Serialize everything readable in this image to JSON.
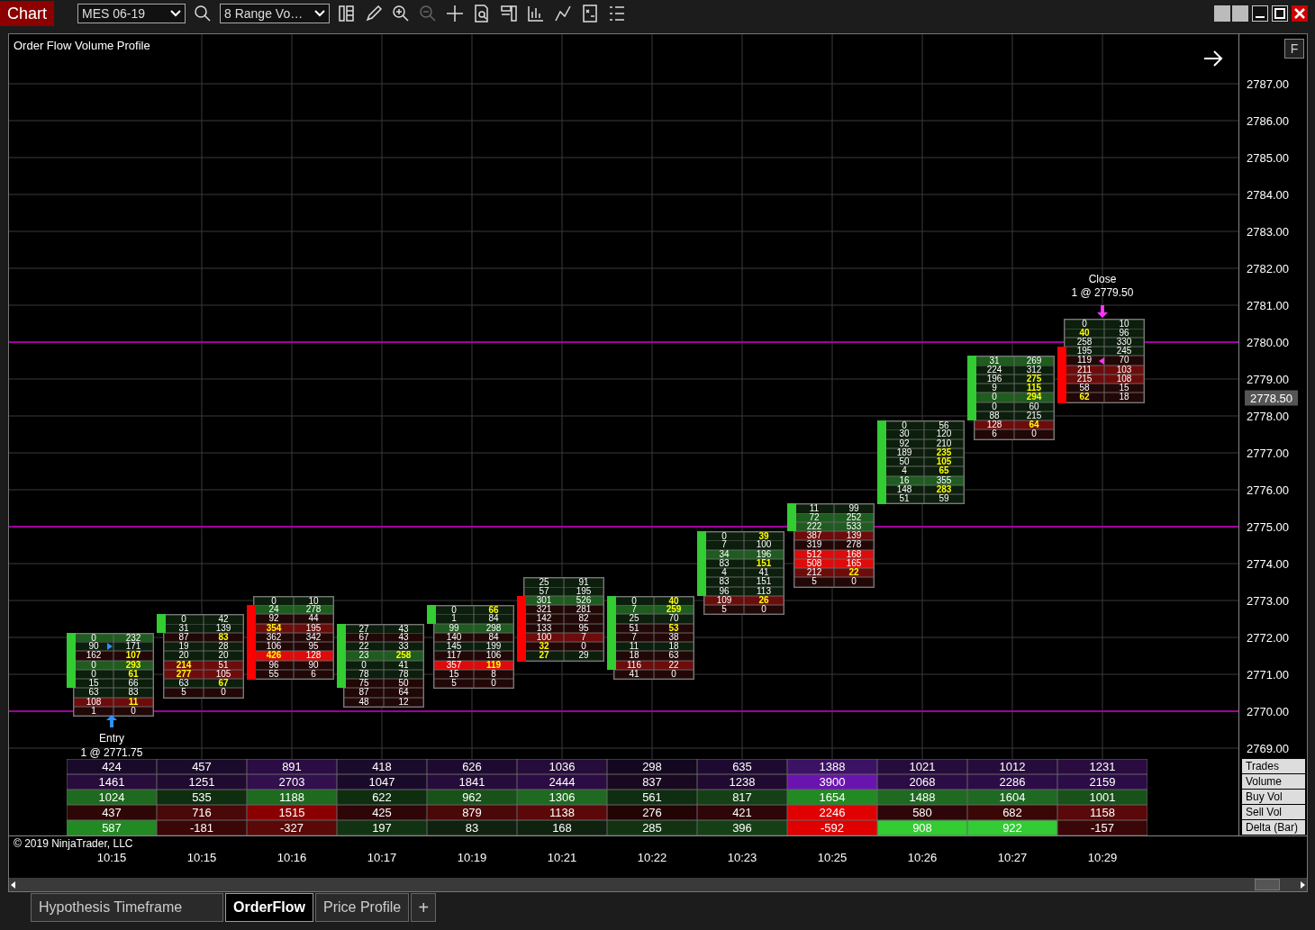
{
  "toolbar": {
    "title": "Chart",
    "instrument": "MES 06-19",
    "bar_type": "8 Range Vo…"
  },
  "chart": {
    "title": "Order Flow Volume Profile",
    "panel_button": "F",
    "current_price": "2778.50",
    "price_ticks": [
      "2787.00",
      "2786.00",
      "2785.00",
      "2784.00",
      "2783.00",
      "2782.00",
      "2781.00",
      "2780.00",
      "2779.00",
      "2778.00",
      "2777.00",
      "2776.00",
      "2775.00",
      "2774.00",
      "2773.00",
      "2772.00",
      "2771.00",
      "2770.00",
      "2769.00"
    ],
    "entry": {
      "label": "Entry",
      "fill": "1 @ 2771.75"
    },
    "close": {
      "label": "Close",
      "fill": "1 @ 2779.50"
    },
    "bars": [
      {
        "time": "10:15",
        "rising": true,
        "rows": [
          {
            "bid": "0",
            "ask": "232",
            "kind": "buy-strong",
            "hot_bid": false,
            "hot_ask": false,
            "body": true
          },
          {
            "bid": "90",
            "ask": "171",
            "kind": "buy",
            "hot_bid": false,
            "hot_ask": false,
            "body": true
          },
          {
            "bid": "162",
            "ask": "107",
            "kind": "sell",
            "hot_bid": false,
            "hot_ask": true,
            "body": true
          },
          {
            "bid": "0",
            "ask": "293",
            "kind": "buy-strong",
            "hot_bid": false,
            "hot_ask": true,
            "body": true
          },
          {
            "bid": "0",
            "ask": "61",
            "kind": "buy",
            "hot_bid": false,
            "hot_ask": true,
            "body": true
          },
          {
            "bid": "15",
            "ask": "66",
            "kind": "buy",
            "hot_bid": false,
            "hot_ask": false,
            "body": true
          },
          {
            "bid": "63",
            "ask": "83",
            "kind": "buy",
            "hot_bid": false,
            "hot_ask": false,
            "body": false
          },
          {
            "bid": "108",
            "ask": "11",
            "kind": "sell-strong",
            "hot_bid": false,
            "hot_ask": true,
            "body": false
          },
          {
            "bid": "1",
            "ask": "0",
            "kind": "sell",
            "hot_bid": false,
            "hot_ask": false,
            "body": false
          }
        ]
      },
      {
        "time": "10:15",
        "rising": true,
        "rows": [
          {
            "bid": "0",
            "ask": "42",
            "kind": "buy",
            "hot_bid": false,
            "hot_ask": false,
            "body": true
          },
          {
            "bid": "31",
            "ask": "139",
            "kind": "buy",
            "hot_bid": false,
            "hot_ask": false,
            "body": true
          },
          {
            "bid": "87",
            "ask": "83",
            "kind": "sell",
            "hot_bid": false,
            "hot_ask": true,
            "body": false
          },
          {
            "bid": "19",
            "ask": "28",
            "kind": "buy",
            "hot_bid": false,
            "hot_ask": false,
            "body": false
          },
          {
            "bid": "20",
            "ask": "20",
            "kind": "buy",
            "hot_bid": false,
            "hot_ask": false,
            "body": false
          },
          {
            "bid": "214",
            "ask": "51",
            "kind": "sell-strong",
            "hot_bid": true,
            "hot_ask": false,
            "body": false
          },
          {
            "bid": "277",
            "ask": "105",
            "kind": "sell-strong",
            "hot_bid": true,
            "hot_ask": false,
            "body": false
          },
          {
            "bid": "63",
            "ask": "67",
            "kind": "buy",
            "hot_bid": false,
            "hot_ask": true,
            "body": false
          },
          {
            "bid": "5",
            "ask": "0",
            "kind": "sell",
            "hot_bid": false,
            "hot_ask": false,
            "body": false
          }
        ]
      },
      {
        "time": "10:16",
        "rising": false,
        "rows": [
          {
            "bid": "0",
            "ask": "10",
            "kind": "buy",
            "hot_bid": false,
            "hot_ask": false,
            "body": false
          },
          {
            "bid": "24",
            "ask": "278",
            "kind": "buy-strong",
            "hot_bid": false,
            "hot_ask": false,
            "body": true
          },
          {
            "bid": "92",
            "ask": "44",
            "kind": "sell",
            "hot_bid": false,
            "hot_ask": false,
            "body": true
          },
          {
            "bid": "354",
            "ask": "195",
            "kind": "sell-strong",
            "hot_bid": true,
            "hot_ask": false,
            "body": true
          },
          {
            "bid": "362",
            "ask": "342",
            "kind": "sell",
            "hot_bid": false,
            "hot_ask": false,
            "body": true
          },
          {
            "bid": "106",
            "ask": "95",
            "kind": "sell",
            "hot_bid": false,
            "hot_ask": false,
            "body": true
          },
          {
            "bid": "426",
            "ask": "128",
            "kind": "sell-max",
            "hot_bid": true,
            "hot_ask": false,
            "body": true
          },
          {
            "bid": "96",
            "ask": "90",
            "kind": "sell",
            "hot_bid": false,
            "hot_ask": false,
            "body": true
          },
          {
            "bid": "55",
            "ask": "6",
            "kind": "sell",
            "hot_bid": false,
            "hot_ask": false,
            "body": true
          }
        ]
      },
      {
        "time": "10:17",
        "rising": true,
        "rows": [
          {
            "bid": "27",
            "ask": "43",
            "kind": "buy",
            "hot_bid": false,
            "hot_ask": false,
            "body": true
          },
          {
            "bid": "67",
            "ask": "43",
            "kind": "sell",
            "hot_bid": false,
            "hot_ask": false,
            "body": true
          },
          {
            "bid": "22",
            "ask": "33",
            "kind": "buy",
            "hot_bid": false,
            "hot_ask": false,
            "body": true
          },
          {
            "bid": "23",
            "ask": "258",
            "kind": "buy-strong",
            "hot_bid": false,
            "hot_ask": true,
            "body": true
          },
          {
            "bid": "0",
            "ask": "41",
            "kind": "buy",
            "hot_bid": false,
            "hot_ask": false,
            "body": true
          },
          {
            "bid": "78",
            "ask": "78",
            "kind": "buy",
            "hot_bid": false,
            "hot_ask": false,
            "body": true
          },
          {
            "bid": "75",
            "ask": "50",
            "kind": "sell",
            "hot_bid": false,
            "hot_ask": false,
            "body": true
          },
          {
            "bid": "87",
            "ask": "64",
            "kind": "sell",
            "hot_bid": false,
            "hot_ask": false,
            "body": false
          },
          {
            "bid": "48",
            "ask": "12",
            "kind": "sell",
            "hot_bid": false,
            "hot_ask": false,
            "body": false
          }
        ]
      },
      {
        "time": "10:19",
        "rising": true,
        "rows": [
          {
            "bid": "0",
            "ask": "66",
            "kind": "buy",
            "hot_bid": false,
            "hot_ask": true,
            "body": true
          },
          {
            "bid": "1",
            "ask": "84",
            "kind": "buy",
            "hot_bid": false,
            "hot_ask": false,
            "body": true
          },
          {
            "bid": "99",
            "ask": "298",
            "kind": "buy-strong",
            "hot_bid": false,
            "hot_ask": false,
            "body": false
          },
          {
            "bid": "140",
            "ask": "84",
            "kind": "sell",
            "hot_bid": false,
            "hot_ask": false,
            "body": false
          },
          {
            "bid": "145",
            "ask": "199",
            "kind": "buy",
            "hot_bid": false,
            "hot_ask": false,
            "body": false
          },
          {
            "bid": "117",
            "ask": "106",
            "kind": "sell",
            "hot_bid": false,
            "hot_ask": false,
            "body": false
          },
          {
            "bid": "357",
            "ask": "119",
            "kind": "sell-max",
            "hot_bid": false,
            "hot_ask": true,
            "body": false
          },
          {
            "bid": "15",
            "ask": "8",
            "kind": "sell",
            "hot_bid": false,
            "hot_ask": false,
            "body": false
          },
          {
            "bid": "5",
            "ask": "0",
            "kind": "sell",
            "hot_bid": false,
            "hot_ask": false,
            "body": false
          }
        ]
      },
      {
        "time": "10:21",
        "rising": false,
        "rows": [
          {
            "bid": "25",
            "ask": "91",
            "kind": "buy",
            "hot_bid": false,
            "hot_ask": false,
            "body": false
          },
          {
            "bid": "57",
            "ask": "195",
            "kind": "buy",
            "hot_bid": false,
            "hot_ask": false,
            "body": false
          },
          {
            "bid": "301",
            "ask": "526",
            "kind": "buy-strong",
            "hot_bid": false,
            "hot_ask": false,
            "body": true
          },
          {
            "bid": "321",
            "ask": "281",
            "kind": "sell",
            "hot_bid": false,
            "hot_ask": false,
            "body": true
          },
          {
            "bid": "142",
            "ask": "82",
            "kind": "sell",
            "hot_bid": false,
            "hot_ask": false,
            "body": true
          },
          {
            "bid": "133",
            "ask": "95",
            "kind": "sell",
            "hot_bid": false,
            "hot_ask": false,
            "body": true
          },
          {
            "bid": "100",
            "ask": "7",
            "kind": "sell-strong",
            "hot_bid": false,
            "hot_ask": false,
            "body": true
          },
          {
            "bid": "32",
            "ask": "0",
            "kind": "sell",
            "hot_bid": true,
            "hot_ask": false,
            "body": true
          },
          {
            "bid": "27",
            "ask": "29",
            "kind": "buy",
            "hot_bid": true,
            "hot_ask": false,
            "body": true
          }
        ]
      },
      {
        "time": "10:22",
        "rising": true,
        "rows": [
          {
            "bid": "0",
            "ask": "40",
            "kind": "buy",
            "hot_bid": false,
            "hot_ask": true,
            "body": true
          },
          {
            "bid": "7",
            "ask": "259",
            "kind": "buy-strong",
            "hot_bid": false,
            "hot_ask": true,
            "body": true
          },
          {
            "bid": "25",
            "ask": "70",
            "kind": "buy",
            "hot_bid": false,
            "hot_ask": false,
            "body": true
          },
          {
            "bid": "51",
            "ask": "53",
            "kind": "sell",
            "hot_bid": false,
            "hot_ask": true,
            "body": true
          },
          {
            "bid": "7",
            "ask": "38",
            "kind": "sell",
            "hot_bid": false,
            "hot_ask": false,
            "body": true
          },
          {
            "bid": "11",
            "ask": "18",
            "kind": "buy",
            "hot_bid": false,
            "hot_ask": false,
            "body": true
          },
          {
            "bid": "18",
            "ask": "63",
            "kind": "sell",
            "hot_bid": false,
            "hot_ask": false,
            "body": true
          },
          {
            "bid": "116",
            "ask": "22",
            "kind": "sell-strong",
            "hot_bid": false,
            "hot_ask": false,
            "body": true
          },
          {
            "bid": "41",
            "ask": "0",
            "kind": "sell",
            "hot_bid": false,
            "hot_ask": false,
            "body": false
          }
        ]
      },
      {
        "time": "10:23",
        "rising": true,
        "rows": [
          {
            "bid": "0",
            "ask": "39",
            "kind": "buy",
            "hot_bid": false,
            "hot_ask": true,
            "body": true
          },
          {
            "bid": "7",
            "ask": "100",
            "kind": "buy",
            "hot_bid": false,
            "hot_ask": false,
            "body": true
          },
          {
            "bid": "34",
            "ask": "196",
            "kind": "buy-strong",
            "hot_bid": false,
            "hot_ask": false,
            "body": true
          },
          {
            "bid": "83",
            "ask": "151",
            "kind": "buy",
            "hot_bid": false,
            "hot_ask": true,
            "body": true
          },
          {
            "bid": "4",
            "ask": "41",
            "kind": "buy",
            "hot_bid": false,
            "hot_ask": false,
            "body": true
          },
          {
            "bid": "83",
            "ask": "151",
            "kind": "buy",
            "hot_bid": false,
            "hot_ask": false,
            "body": true
          },
          {
            "bid": "96",
            "ask": "113",
            "kind": "buy",
            "hot_bid": false,
            "hot_ask": false,
            "body": true
          },
          {
            "bid": "109",
            "ask": "26",
            "kind": "sell-strong",
            "hot_bid": false,
            "hot_ask": true,
            "body": false
          },
          {
            "bid": "5",
            "ask": "0",
            "kind": "sell",
            "hot_bid": false,
            "hot_ask": false,
            "body": false
          }
        ]
      },
      {
        "time": "10:25",
        "rising": true,
        "rows": [
          {
            "bid": "11",
            "ask": "99",
            "kind": "buy",
            "hot_bid": false,
            "hot_ask": false,
            "body": true
          },
          {
            "bid": "72",
            "ask": "252",
            "kind": "buy-strong",
            "hot_bid": false,
            "hot_ask": false,
            "body": true
          },
          {
            "bid": "222",
            "ask": "533",
            "kind": "buy-strong",
            "hot_bid": false,
            "hot_ask": false,
            "body": true
          },
          {
            "bid": "387",
            "ask": "139",
            "kind": "sell-strong",
            "hot_bid": false,
            "hot_ask": false,
            "body": false
          },
          {
            "bid": "319",
            "ask": "278",
            "kind": "sell",
            "hot_bid": false,
            "hot_ask": false,
            "body": false
          },
          {
            "bid": "512",
            "ask": "168",
            "kind": "sell-max",
            "hot_bid": false,
            "hot_ask": false,
            "body": false
          },
          {
            "bid": "508",
            "ask": "165",
            "kind": "sell-max",
            "hot_bid": false,
            "hot_ask": false,
            "body": false
          },
          {
            "bid": "212",
            "ask": "22",
            "kind": "sell-strong",
            "hot_bid": false,
            "hot_ask": true,
            "body": false
          },
          {
            "bid": "5",
            "ask": "0",
            "kind": "sell",
            "hot_bid": false,
            "hot_ask": false,
            "body": false
          }
        ]
      },
      {
        "time": "10:26",
        "rising": true,
        "rows": [
          {
            "bid": "0",
            "ask": "56",
            "kind": "buy",
            "hot_bid": false,
            "hot_ask": false,
            "body": true
          },
          {
            "bid": "30",
            "ask": "120",
            "kind": "buy",
            "hot_bid": false,
            "hot_ask": false,
            "body": true
          },
          {
            "bid": "92",
            "ask": "210",
            "kind": "buy",
            "hot_bid": false,
            "hot_ask": false,
            "body": true
          },
          {
            "bid": "189",
            "ask": "235",
            "kind": "buy",
            "hot_bid": false,
            "hot_ask": true,
            "body": true
          },
          {
            "bid": "50",
            "ask": "105",
            "kind": "buy",
            "hot_bid": false,
            "hot_ask": true,
            "body": true
          },
          {
            "bid": "4",
            "ask": "65",
            "kind": "buy",
            "hot_bid": false,
            "hot_ask": true,
            "body": true
          },
          {
            "bid": "16",
            "ask": "355",
            "kind": "buy-strong",
            "hot_bid": false,
            "hot_ask": false,
            "body": true
          },
          {
            "bid": "148",
            "ask": "283",
            "kind": "buy",
            "hot_bid": false,
            "hot_ask": true,
            "body": true
          },
          {
            "bid": "51",
            "ask": "59",
            "kind": "buy",
            "hot_bid": false,
            "hot_ask": false,
            "body": true
          }
        ]
      },
      {
        "time": "10:27",
        "rising": true,
        "rows": [
          {
            "bid": "31",
            "ask": "269",
            "kind": "buy-strong",
            "hot_bid": false,
            "hot_ask": false,
            "body": true
          },
          {
            "bid": "224",
            "ask": "312",
            "kind": "buy",
            "hot_bid": false,
            "hot_ask": false,
            "body": true
          },
          {
            "bid": "196",
            "ask": "275",
            "kind": "buy",
            "hot_bid": false,
            "hot_ask": true,
            "body": true
          },
          {
            "bid": "9",
            "ask": "115",
            "kind": "buy",
            "hot_bid": false,
            "hot_ask": true,
            "body": true
          },
          {
            "bid": "0",
            "ask": "294",
            "kind": "buy-strong",
            "hot_bid": false,
            "hot_ask": true,
            "body": true
          },
          {
            "bid": "0",
            "ask": "60",
            "kind": "buy",
            "hot_bid": false,
            "hot_ask": false,
            "body": true
          },
          {
            "bid": "88",
            "ask": "215",
            "kind": "buy",
            "hot_bid": false,
            "hot_ask": false,
            "body": true
          },
          {
            "bid": "128",
            "ask": "64",
            "kind": "sell-strong",
            "hot_bid": false,
            "hot_ask": true,
            "body": false
          },
          {
            "bid": "6",
            "ask": "0",
            "kind": "sell",
            "hot_bid": false,
            "hot_ask": false,
            "body": false
          }
        ]
      },
      {
        "time": "10:29",
        "rising": false,
        "rows": [
          {
            "bid": "0",
            "ask": "10",
            "kind": "buy",
            "hot_bid": false,
            "hot_ask": false,
            "body": false
          },
          {
            "bid": "40",
            "ask": "96",
            "kind": "buy",
            "hot_bid": true,
            "hot_ask": false,
            "body": false
          },
          {
            "bid": "258",
            "ask": "330",
            "kind": "buy",
            "hot_bid": false,
            "hot_ask": false,
            "body": false
          },
          {
            "bid": "195",
            "ask": "245",
            "kind": "buy",
            "hot_bid": false,
            "hot_ask": false,
            "body": true
          },
          {
            "bid": "119",
            "ask": "70",
            "kind": "sell",
            "hot_bid": false,
            "hot_ask": false,
            "body": true
          },
          {
            "bid": "211",
            "ask": "103",
            "kind": "sell-strong",
            "hot_bid": false,
            "hot_ask": false,
            "body": true
          },
          {
            "bid": "215",
            "ask": "108",
            "kind": "sell-strong",
            "hot_bid": false,
            "hot_ask": false,
            "body": true
          },
          {
            "bid": "58",
            "ask": "15",
            "kind": "sell",
            "hot_bid": false,
            "hot_ask": false,
            "body": true
          },
          {
            "bid": "62",
            "ask": "18",
            "kind": "sell",
            "hot_bid": true,
            "hot_ask": false,
            "body": true
          }
        ]
      }
    ],
    "stats": [
      {
        "label": "Trades",
        "cells": [
          {
            "value": "424",
            "color": "#1a0a2a"
          },
          {
            "value": "457",
            "color": "#1a0a2b"
          },
          {
            "value": "891",
            "color": "#2c0c44"
          },
          {
            "value": "418",
            "color": "#1a0a2c"
          },
          {
            "value": "626",
            "color": "#1e0a30"
          },
          {
            "value": "1036",
            "color": "#260c3a"
          },
          {
            "value": "298",
            "color": "#140820"
          },
          {
            "value": "635",
            "color": "#1e0a31"
          },
          {
            "value": "1388",
            "color": "#3c1264"
          },
          {
            "value": "1021",
            "color": "#260c3b"
          },
          {
            "value": "1012",
            "color": "#260c3c"
          },
          {
            "value": "1231",
            "color": "#2a0c40"
          }
        ]
      },
      {
        "label": "Volume",
        "cells": [
          {
            "value": "1461",
            "color": "#280c3c"
          },
          {
            "value": "1251",
            "color": "#200a30"
          },
          {
            "value": "2703",
            "color": "#32104e"
          },
          {
            "value": "1047",
            "color": "#1a0a2a"
          },
          {
            "value": "1841",
            "color": "#260c3a"
          },
          {
            "value": "2444",
            "color": "#2c0c44"
          },
          {
            "value": "837",
            "color": "#180820"
          },
          {
            "value": "1238",
            "color": "#200a31"
          },
          {
            "value": "3900",
            "color": "#6a14b0"
          },
          {
            "value": "2068",
            "color": "#2c0c45"
          },
          {
            "value": "2286",
            "color": "#2c0c46"
          },
          {
            "value": "2159",
            "color": "#2c0c47"
          }
        ]
      },
      {
        "label": "Buy Vol",
        "cells": [
          {
            "value": "1024",
            "color": "#1e6a1e"
          },
          {
            "value": "535",
            "color": "#0f2e0f"
          },
          {
            "value": "1188",
            "color": "#1e6a1f"
          },
          {
            "value": "622",
            "color": "#0f2e10"
          },
          {
            "value": "962",
            "color": "#185218"
          },
          {
            "value": "1306",
            "color": "#1e6a20"
          },
          {
            "value": "561",
            "color": "#0f2e11"
          },
          {
            "value": "817",
            "color": "#154015"
          },
          {
            "value": "1654",
            "color": "#228a22"
          },
          {
            "value": "1488",
            "color": "#1e6a21"
          },
          {
            "value": "1604",
            "color": "#1e6a22"
          },
          {
            "value": "1001",
            "color": "#185219"
          }
        ]
      },
      {
        "label": "Sell Vol",
        "cells": [
          {
            "value": "437",
            "color": "#2e0606"
          },
          {
            "value": "716",
            "color": "#4a0808"
          },
          {
            "value": "1515",
            "color": "#8a0000"
          },
          {
            "value": "425",
            "color": "#2e0607"
          },
          {
            "value": "879",
            "color": "#4a0809"
          },
          {
            "value": "1138",
            "color": "#5a0808"
          },
          {
            "value": "276",
            "color": "#220404"
          },
          {
            "value": "421",
            "color": "#2e0608"
          },
          {
            "value": "2246",
            "color": "#e00000"
          },
          {
            "value": "580",
            "color": "#2e0609"
          },
          {
            "value": "682",
            "color": "#3a0606"
          },
          {
            "value": "1158",
            "color": "#5a0809"
          }
        ]
      },
      {
        "label": "Delta (Bar)",
        "cells": [
          {
            "value": "587",
            "color": "#228a22"
          },
          {
            "value": "-181",
            "color": "#3a0606"
          },
          {
            "value": "-327",
            "color": "#5a0808"
          },
          {
            "value": "197",
            "color": "#113311"
          },
          {
            "value": "83",
            "color": "#0f220f"
          },
          {
            "value": "168",
            "color": "#0f2210"
          },
          {
            "value": "285",
            "color": "#113312"
          },
          {
            "value": "396",
            "color": "#154015"
          },
          {
            "value": "-592",
            "color": "#e00000"
          },
          {
            "value": "908",
            "color": "#33cc33"
          },
          {
            "value": "922",
            "color": "#33cc34"
          },
          {
            "value": "-157",
            "color": "#3a0607"
          }
        ]
      }
    ],
    "copyright": "© 2019 NinjaTrader, LLC"
  },
  "tabs": [
    {
      "label": "Hypothesis Timeframe",
      "selected": false
    },
    {
      "label": "OrderFlow",
      "selected": true
    },
    {
      "label": "Price Profile",
      "selected": false
    }
  ],
  "add_tab": "+"
}
